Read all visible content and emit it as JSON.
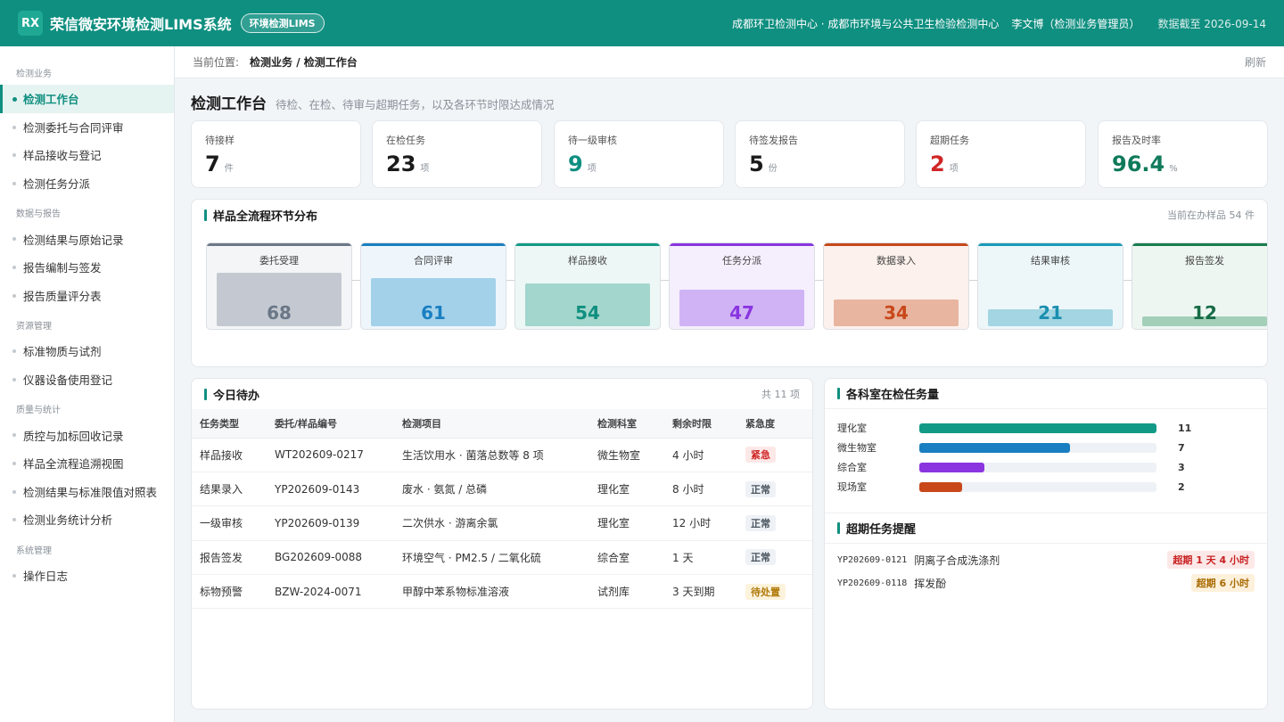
{
  "header": {
    "logo": "RX",
    "app_name": "荣信微安环境检测LIMS系统",
    "badge": "环境检测LIMS",
    "org": "成都环卫检测中心 · 成都市环境与公共卫生检验检测中心",
    "user": "李文博（检测业务管理员）",
    "date": "数据截至 2026-09-14"
  },
  "sidebar": {
    "groups": [
      {
        "title": "检测业务",
        "items": [
          "检测工作台",
          "检测委托与合同评审",
          "样品接收与登记",
          "检测任务分派"
        ]
      },
      {
        "title": "数据与报告",
        "items": [
          "检测结果与原始记录",
          "报告编制与签发",
          "报告质量评分表"
        ]
      },
      {
        "title": "资源管理",
        "items": [
          "标准物质与试剂",
          "仪器设备使用登记"
        ]
      },
      {
        "title": "质量与统计",
        "items": [
          "质控与加标回收记录",
          "样品全流程追溯视图",
          "检测结果与标准限值对照表",
          "检测业务统计分析"
        ]
      },
      {
        "title": "系统管理",
        "items": [
          "操作日志"
        ]
      }
    ]
  },
  "breadcrumb": {
    "label": "当前位置:",
    "path": "检测业务 / 检测工作台",
    "refresh": "刷新"
  },
  "page": {
    "title": "检测工作台",
    "desc": "待检、在检、待审与超期任务，以及各环节时限达成情况"
  },
  "kpis": [
    {
      "label": "待接样",
      "value": "7",
      "unit": "件",
      "color": "#1a1a1a"
    },
    {
      "label": "在检任务",
      "value": "23",
      "unit": "项",
      "color": "#1a1a1a"
    },
    {
      "label": "待一级审核",
      "value": "9",
      "unit": "项",
      "color": "#0f8f80"
    },
    {
      "label": "待签发报告",
      "value": "5",
      "unit": "份",
      "color": "#1a1a1a"
    },
    {
      "label": "超期任务",
      "value": "2",
      "unit": "项",
      "color": "#d02626"
    },
    {
      "label": "报告及时率",
      "value": "96.4",
      "unit": "%",
      "color": "#0f7a5a"
    }
  ],
  "flow": {
    "title": "样品全流程环节分布",
    "sub": "当前在办样品 54 件",
    "max": 68,
    "stages": [
      {
        "name": "委托受理",
        "value": 68,
        "top": "#6b7787",
        "bg": "#f4f5f7",
        "bar": "#c4c9d1",
        "num": "#6b7787"
      },
      {
        "name": "合同评审",
        "value": 61,
        "top": "#1a7fc0",
        "bg": "#eef6fc",
        "bar": "#a3d1ea",
        "num": "#1a7fc0"
      },
      {
        "name": "样品接收",
        "value": 54,
        "top": "#139a86",
        "bg": "#edf7f5",
        "bar": "#a3d6cc",
        "num": "#0f8f80"
      },
      {
        "name": "任务分派",
        "value": 47,
        "top": "#8a35e0",
        "bg": "#f5effd",
        "bar": "#cfb3f5",
        "num": "#8a35e0"
      },
      {
        "name": "数据录入",
        "value": 34,
        "top": "#c8481a",
        "bg": "#fcf1ec",
        "bar": "#e8b5a0",
        "num": "#c8481a"
      },
      {
        "name": "结果审核",
        "value": 21,
        "top": "#1a9ab8",
        "bg": "#edf7fa",
        "bar": "#a3d5e2",
        "num": "#1a8fb0"
      },
      {
        "name": "报告签发",
        "value": 12,
        "top": "#1a7d4f",
        "bg": "#eef6f2",
        "bar": "#a3cfb8",
        "num": "#166b45"
      }
    ]
  },
  "todo": {
    "title": "今日待办",
    "sub": "共 11 项",
    "columns": [
      "任务类型",
      "委托/样品编号",
      "检测项目",
      "检测科室",
      "剩余时限",
      "紧急度"
    ],
    "rows": [
      {
        "type": "样品接收",
        "id": "WT202609-0217",
        "item": "生活饮用水 · 菌落总数等 8 项",
        "dept": "微生物室",
        "remain": "4 小时",
        "level": "紧急",
        "kind": "urgent"
      },
      {
        "type": "结果录入",
        "id": "YP202609-0143",
        "item": "废水 · 氨氮 / 总磷",
        "dept": "理化室",
        "remain": "8 小时",
        "level": "正常",
        "kind": "normal"
      },
      {
        "type": "一级审核",
        "id": "YP202609-0139",
        "item": "二次供水 · 游离余氯",
        "dept": "理化室",
        "remain": "12 小时",
        "level": "正常",
        "kind": "normal"
      },
      {
        "type": "报告签发",
        "id": "BG202609-0088",
        "item": "环境空气 · PM2.5 / 二氧化硫",
        "dept": "综合室",
        "remain": "1 天",
        "level": "正常",
        "kind": "normal"
      },
      {
        "type": "标物预警",
        "id": "BZW-2024-0071",
        "item": "甲醇中苯系物标准溶液",
        "dept": "试剂库",
        "remain": "3 天到期",
        "level": "待处置",
        "kind": "pending"
      }
    ]
  },
  "labs": {
    "title": "各科室在检任务量",
    "max": 11,
    "items": [
      {
        "name": "理化室",
        "value": 11,
        "color": "#139a86"
      },
      {
        "name": "微生物室",
        "value": 7,
        "color": "#1a7fc0"
      },
      {
        "name": "综合室",
        "value": 3,
        "color": "#8a35e0"
      },
      {
        "name": "现场室",
        "value": 2,
        "color": "#c8481a"
      }
    ]
  },
  "overdue": {
    "title": "超期任务提醒",
    "items": [
      {
        "id": "YP202609-0121",
        "name": "阴离子合成洗涤剂",
        "tag": "超期 1 天 4 小时",
        "bg": "#fde8e8",
        "fg": "#c82020"
      },
      {
        "id": "YP202609-0118",
        "name": "挥发酚",
        "tag": "超期 6 小时",
        "bg": "#fdf1dc",
        "fg": "#a86a00"
      }
    ]
  }
}
